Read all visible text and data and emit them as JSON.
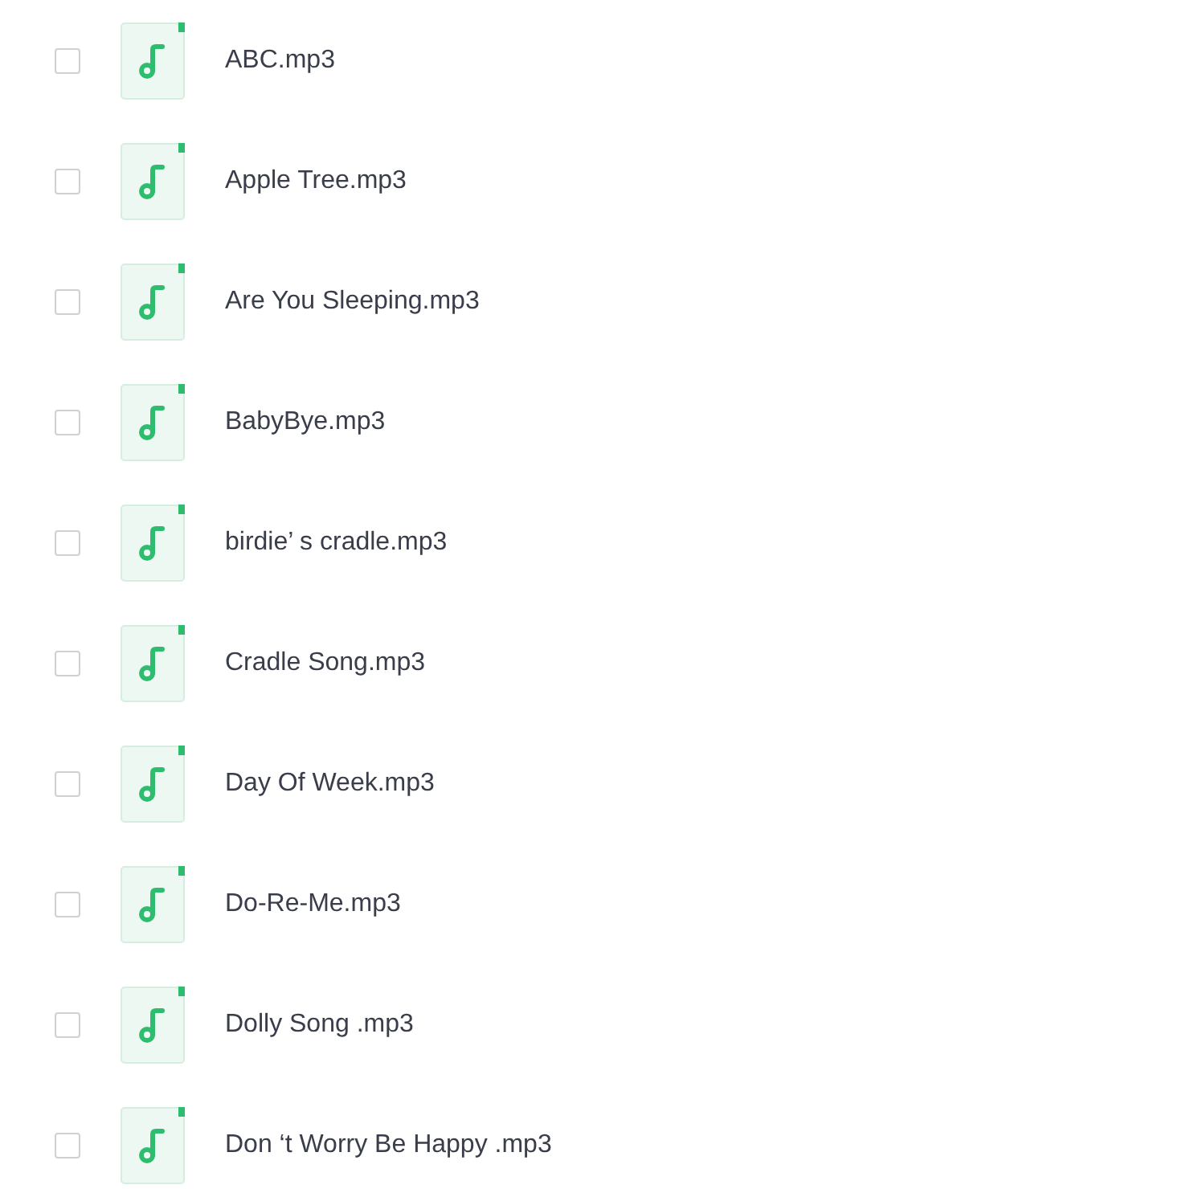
{
  "files": [
    {
      "name": "ABC.mp3",
      "checked": false
    },
    {
      "name": "Apple Tree.mp3",
      "checked": false
    },
    {
      "name": "Are You Sleeping.mp3",
      "checked": false
    },
    {
      "name": "BabyBye.mp3",
      "checked": false
    },
    {
      "name": "birdie’ s cradle.mp3",
      "checked": false
    },
    {
      "name": "Cradle Song.mp3",
      "checked": false
    },
    {
      "name": "Day Of Week.mp3",
      "checked": false
    },
    {
      "name": "Do-Re-Me.mp3",
      "checked": false
    },
    {
      "name": "Dolly Song .mp3",
      "checked": false
    },
    {
      "name": "Don ‘t Worry Be Happy .mp3",
      "checked": false
    }
  ]
}
